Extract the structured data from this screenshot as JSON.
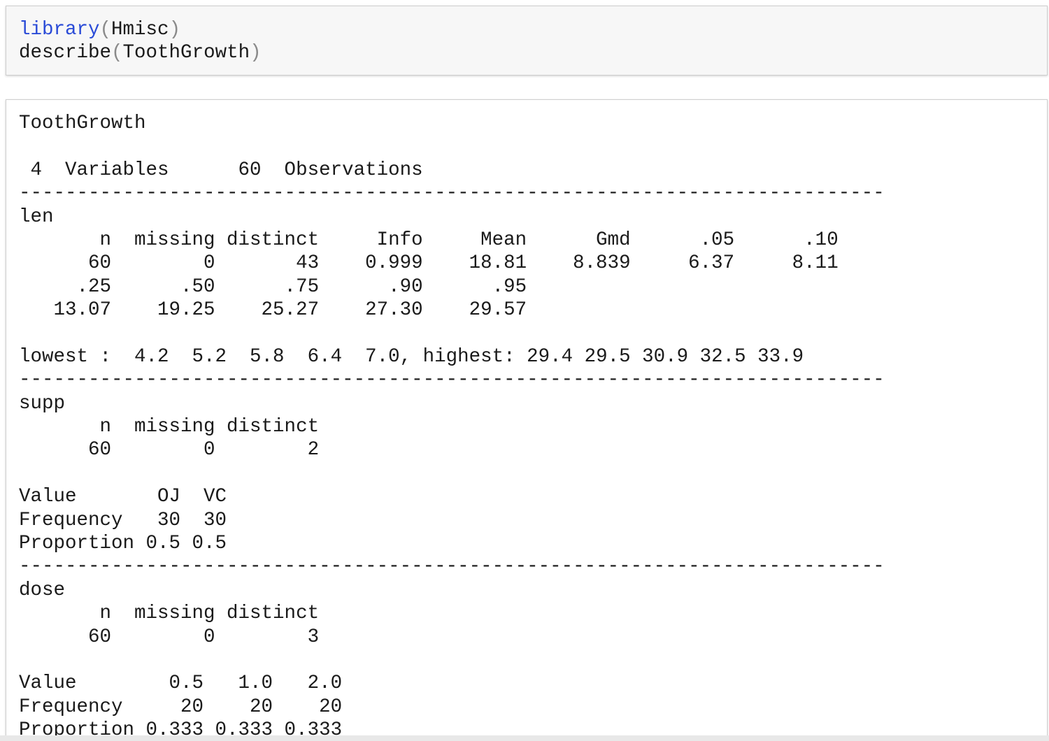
{
  "input_cell": {
    "line1": {
      "func": "library",
      "arg": "Hmisc"
    },
    "line2": {
      "func": "describe",
      "arg": "ToothGrowth"
    }
  },
  "output_lines": [
    "ToothGrowth",
    "",
    " 4  Variables      60  Observations",
    "---------------------------------------------------------------------------",
    "len",
    "       n  missing distinct     Info     Mean      Gmd      .05      .10",
    "      60        0       43    0.999    18.81    8.839     6.37     8.11",
    "     .25      .50      .75      .90      .95",
    "   13.07    19.25    25.27    27.30    29.57",
    "",
    "lowest :  4.2  5.2  5.8  6.4  7.0, highest: 29.4 29.5 30.9 32.5 33.9",
    "---------------------------------------------------------------------------",
    "supp",
    "       n  missing distinct",
    "      60        0        2",
    "",
    "Value       OJ  VC",
    "Frequency   30  30",
    "Proportion 0.5 0.5",
    "---------------------------------------------------------------------------",
    "dose",
    "       n  missing distinct",
    "      60        0        3",
    "",
    "Value        0.5   1.0   2.0",
    "Frequency     20    20    20",
    "Proportion 0.333 0.333 0.333"
  ]
}
